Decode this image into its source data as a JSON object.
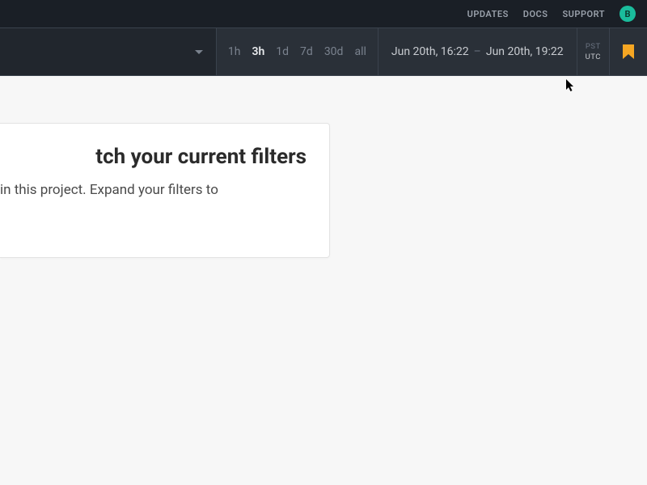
{
  "topbar": {
    "links": [
      "UPDATES",
      "DOCS",
      "SUPPORT"
    ],
    "avatar_initial": "B"
  },
  "toolbar": {
    "time_ranges": [
      {
        "label": "1h",
        "active": false
      },
      {
        "label": "3h",
        "active": true
      },
      {
        "label": "1d",
        "active": false
      },
      {
        "label": "7d",
        "active": false
      },
      {
        "label": "30d",
        "active": false
      },
      {
        "label": "all",
        "active": false
      }
    ],
    "date_start": "Jun 20th, 16:22",
    "date_end": "Jun 20th, 19:22",
    "timezones": [
      {
        "label": "PST",
        "active": false
      },
      {
        "label": "UTC",
        "active": true
      }
    ]
  },
  "card": {
    "title_visible": "tch your current filters",
    "body_line1": "in this project. Expand your filters to"
  }
}
